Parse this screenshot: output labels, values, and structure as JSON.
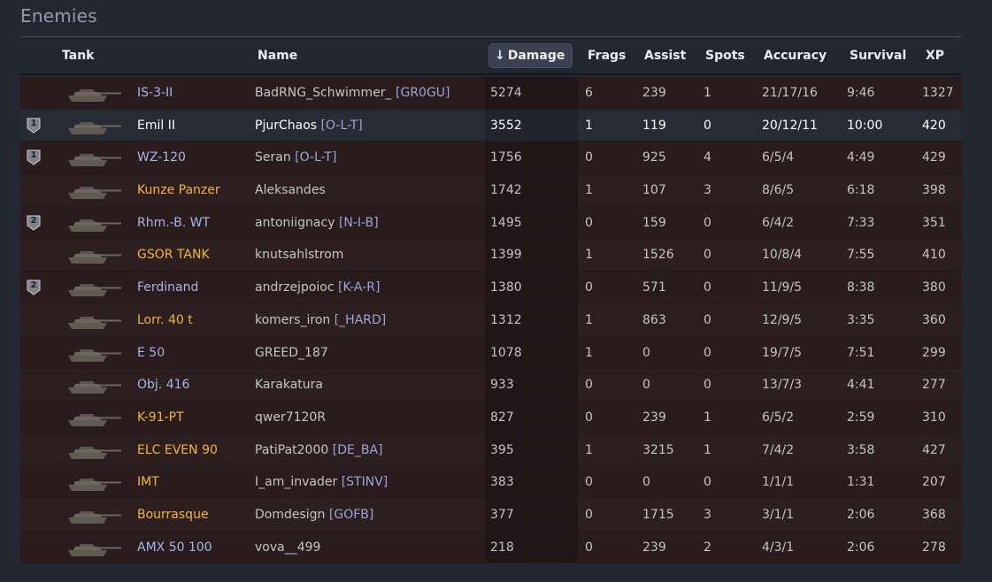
{
  "section_title": "Enemies",
  "columns": {
    "tank": "Tank",
    "name": "Name",
    "damage": "Damage",
    "frags": "Frags",
    "assist": "Assist",
    "spots": "Spots",
    "accuracy": "Accuracy",
    "survival": "Survival",
    "xp": "XP"
  },
  "sort_arrow": "↓",
  "colors": {
    "tank_light": "#a7b5e6",
    "tank_premium": "#f4b630",
    "clan_tag": "#9aa5d8",
    "row_bg": "#2a1c1d",
    "highlight_row_bg": "#262b34"
  },
  "rows": [
    {
      "badge": "",
      "tank": "IS-3-II",
      "tank_color": "light",
      "name": "BadRNG_Schwimmer_",
      "clan": "[GR0GU]",
      "damage": "5274",
      "frags": "6",
      "assist": "239",
      "spots": "1",
      "accuracy": "21/17/16",
      "survival": "9:46",
      "xp": "1327",
      "highlight": false
    },
    {
      "badge": "1",
      "tank": "Emil II",
      "tank_color": "light",
      "name": "PjurChaos",
      "clan": "[O-L-T]",
      "damage": "3552",
      "frags": "1",
      "assist": "119",
      "spots": "0",
      "accuracy": "20/12/11",
      "survival": "10:00",
      "xp": "420",
      "highlight": true
    },
    {
      "badge": "1",
      "tank": "WZ-120",
      "tank_color": "light",
      "name": "Seran",
      "clan": "[O-L-T]",
      "damage": "1756",
      "frags": "0",
      "assist": "925",
      "spots": "4",
      "accuracy": "6/5/4",
      "survival": "4:49",
      "xp": "429",
      "highlight": false
    },
    {
      "badge": "",
      "tank": "Kunze Panzer",
      "tank_color": "gold",
      "name": "Aleksandes",
      "clan": "",
      "damage": "1742",
      "frags": "1",
      "assist": "107",
      "spots": "3",
      "accuracy": "8/6/5",
      "survival": "6:18",
      "xp": "398",
      "highlight": false
    },
    {
      "badge": "2",
      "tank": "Rhm.-B. WT",
      "tank_color": "light",
      "name": "antoniignacy",
      "clan": "[N-I-B]",
      "damage": "1495",
      "frags": "0",
      "assist": "159",
      "spots": "0",
      "accuracy": "6/4/2",
      "survival": "7:33",
      "xp": "351",
      "highlight": false
    },
    {
      "badge": "",
      "tank": "GSOR TANK",
      "tank_color": "gold",
      "name": "knutsahlstrom",
      "clan": "",
      "damage": "1399",
      "frags": "1",
      "assist": "1526",
      "spots": "0",
      "accuracy": "10/8/4",
      "survival": "7:55",
      "xp": "410",
      "highlight": false
    },
    {
      "badge": "2",
      "tank": "Ferdinand",
      "tank_color": "light",
      "name": "andrzejpoioc",
      "clan": "[K-A-R]",
      "damage": "1380",
      "frags": "0",
      "assist": "571",
      "spots": "0",
      "accuracy": "11/9/5",
      "survival": "8:38",
      "xp": "380",
      "highlight": false
    },
    {
      "badge": "",
      "tank": "Lorr. 40 t",
      "tank_color": "gold",
      "name": "komers_iron",
      "clan": "[_HARD]",
      "damage": "1312",
      "frags": "1",
      "assist": "863",
      "spots": "0",
      "accuracy": "12/9/5",
      "survival": "3:35",
      "xp": "360",
      "highlight": false
    },
    {
      "badge": "",
      "tank": "E 50",
      "tank_color": "light",
      "name": "GREED_187",
      "clan": "",
      "damage": "1078",
      "frags": "1",
      "assist": "0",
      "spots": "0",
      "accuracy": "19/7/5",
      "survival": "7:51",
      "xp": "299",
      "highlight": false
    },
    {
      "badge": "",
      "tank": "Obj. 416",
      "tank_color": "light",
      "name": "Karakatura",
      "clan": "",
      "damage": "933",
      "frags": "0",
      "assist": "0",
      "spots": "0",
      "accuracy": "13/7/3",
      "survival": "4:41",
      "xp": "277",
      "highlight": false
    },
    {
      "badge": "",
      "tank": "K-91-PT",
      "tank_color": "gold",
      "name": "qwer7120R",
      "clan": "",
      "damage": "827",
      "frags": "0",
      "assist": "239",
      "spots": "1",
      "accuracy": "6/5/2",
      "survival": "2:59",
      "xp": "310",
      "highlight": false
    },
    {
      "badge": "",
      "tank": "ELC EVEN 90",
      "tank_color": "gold",
      "name": "PatiPat2000",
      "clan": "[DE_BA]",
      "damage": "395",
      "frags": "1",
      "assist": "3215",
      "spots": "1",
      "accuracy": "7/4/2",
      "survival": "3:58",
      "xp": "427",
      "highlight": false
    },
    {
      "badge": "",
      "tank": "IMT",
      "tank_color": "gold",
      "name": "I_am_invader",
      "clan": "[STINV]",
      "damage": "383",
      "frags": "0",
      "assist": "0",
      "spots": "0",
      "accuracy": "1/1/1",
      "survival": "1:31",
      "xp": "207",
      "highlight": false
    },
    {
      "badge": "",
      "tank": "Bourrasque",
      "tank_color": "gold",
      "name": "Domdesign",
      "clan": "[GOFB]",
      "damage": "377",
      "frags": "0",
      "assist": "1715",
      "spots": "3",
      "accuracy": "3/1/1",
      "survival": "2:06",
      "xp": "368",
      "highlight": false
    },
    {
      "badge": "",
      "tank": "AMX 50 100",
      "tank_color": "light",
      "name": "vova__499",
      "clan": "",
      "damage": "218",
      "frags": "0",
      "assist": "239",
      "spots": "2",
      "accuracy": "4/3/1",
      "survival": "2:06",
      "xp": "278",
      "highlight": false
    }
  ]
}
